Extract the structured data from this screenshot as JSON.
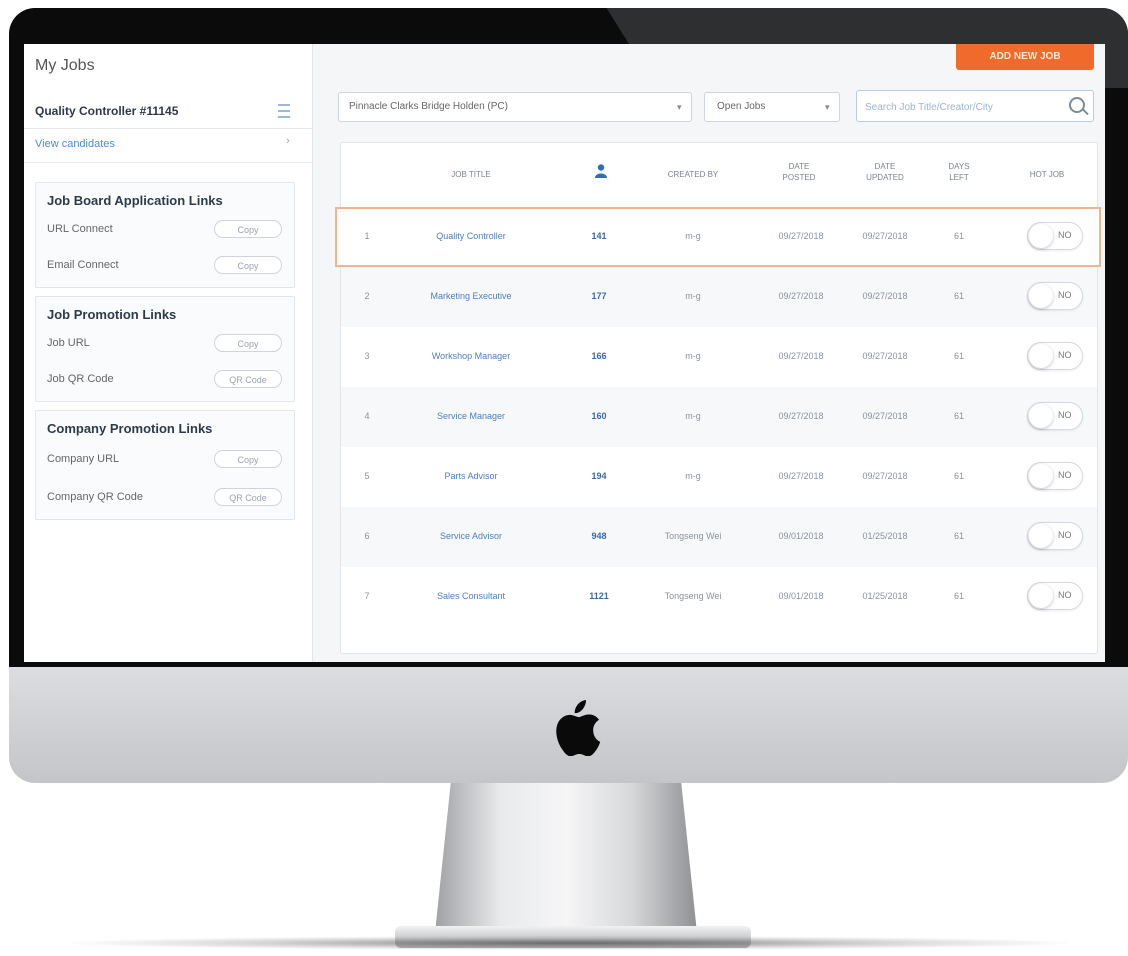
{
  "app": {
    "page_title": "My Jobs",
    "job_heading": "Quality Controller #11145",
    "view_candidates": "View candidates",
    "chevron": "›"
  },
  "panels": [
    {
      "title": "Job Board Application Links",
      "rows": [
        {
          "label": "URL Connect",
          "button": "Copy"
        },
        {
          "label": "Email Connect",
          "button": "Copy"
        }
      ]
    },
    {
      "title": "Job Promotion Links",
      "rows": [
        {
          "label": "Job URL",
          "button": "Copy"
        },
        {
          "label": "Job QR Code",
          "button": "QR Code"
        }
      ]
    },
    {
      "title": "Company Promotion Links",
      "rows": [
        {
          "label": "Company URL",
          "button": "Copy"
        },
        {
          "label": "Company QR Code",
          "button": "QR Code"
        }
      ]
    }
  ],
  "toolbar": {
    "add_job": "ADD NEW JOB",
    "dealer_filter": "Pinnacle Clarks Bridge Holden (PC)",
    "status_filter": "Open Jobs",
    "search_placeholder": "Search Job Title/Creator/City"
  },
  "table": {
    "headers": {
      "title": "JOB TITLE",
      "created_by": "CREATED BY",
      "posted": [
        "DATE",
        "POSTED"
      ],
      "updated": [
        "DATE",
        "UPDATED"
      ],
      "days_left": [
        "DAYS",
        "LEFT"
      ],
      "hot_job": "HOT JOB"
    },
    "rows": [
      {
        "num": "1",
        "title": "Quality Controller",
        "apps": "141",
        "creator": "m-g",
        "posted": "09/27/2018",
        "updated": "09/27/2018",
        "days": "61",
        "hot": "NO"
      },
      {
        "num": "2",
        "title": "Marketing Executive",
        "apps": "177",
        "creator": "m-g",
        "posted": "09/27/2018",
        "updated": "09/27/2018",
        "days": "61",
        "hot": "NO"
      },
      {
        "num": "3",
        "title": "Workshop Manager",
        "apps": "166",
        "creator": "m-g",
        "posted": "09/27/2018",
        "updated": "09/27/2018",
        "days": "61",
        "hot": "NO"
      },
      {
        "num": "4",
        "title": "Service Manager",
        "apps": "160",
        "creator": "m-g",
        "posted": "09/27/2018",
        "updated": "09/27/2018",
        "days": "61",
        "hot": "NO"
      },
      {
        "num": "5",
        "title": "Parts Advisor",
        "apps": "194",
        "creator": "m-g",
        "posted": "09/27/2018",
        "updated": "09/27/2018",
        "days": "61",
        "hot": "NO"
      },
      {
        "num": "6",
        "title": "Service Advisor",
        "apps": "948",
        "creator": "Tongseng Wei",
        "posted": "09/01/2018",
        "updated": "01/25/2018",
        "days": "61",
        "hot": "NO"
      },
      {
        "num": "7",
        "title": "Sales Consultant",
        "apps": "1121",
        "creator": "Tongseng Wei",
        "posted": "09/01/2018",
        "updated": "01/25/2018",
        "days": "61",
        "hot": "NO"
      }
    ]
  },
  "colors": {
    "accent": "#f06a2b",
    "link": "#4a7fc1",
    "selected_outline": "#f0b58f"
  },
  "icons": {
    "menu": "list-icon",
    "search": "search-icon",
    "user": "person-icon",
    "brand": "apple-logo"
  }
}
